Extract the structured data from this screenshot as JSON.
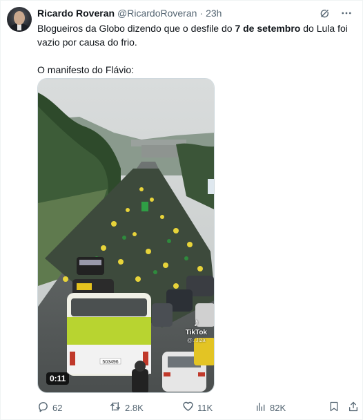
{
  "tweet": {
    "author_name": "Ricardo Roveran",
    "author_handle": "@RicardoRoveran",
    "separator": "·",
    "time": "23h",
    "text_part1": "Blogueiros da Globo dizendo que o desfile do ",
    "text_bold": "7 de setembro",
    "text_part2": " do Lula foi vazio por causa do frio.",
    "text_line2": "O manifesto do Flávio:"
  },
  "media": {
    "duration": "0:11",
    "watermark_brand": "TikTok",
    "watermark_user": "@...liza",
    "bus_number": "503496"
  },
  "actions": {
    "replies": "62",
    "reposts": "2.8K",
    "likes": "11K",
    "views": "82K"
  },
  "icons": {
    "grok": "grok-icon",
    "more": "more-icon",
    "reply": "reply-icon",
    "repost": "repost-icon",
    "like": "heart-icon",
    "views": "views-icon",
    "bookmark": "bookmark-icon",
    "share": "share-icon"
  },
  "colors": {
    "text_primary": "#0f1419",
    "text_secondary": "#536471",
    "border": "#cfd9de"
  }
}
